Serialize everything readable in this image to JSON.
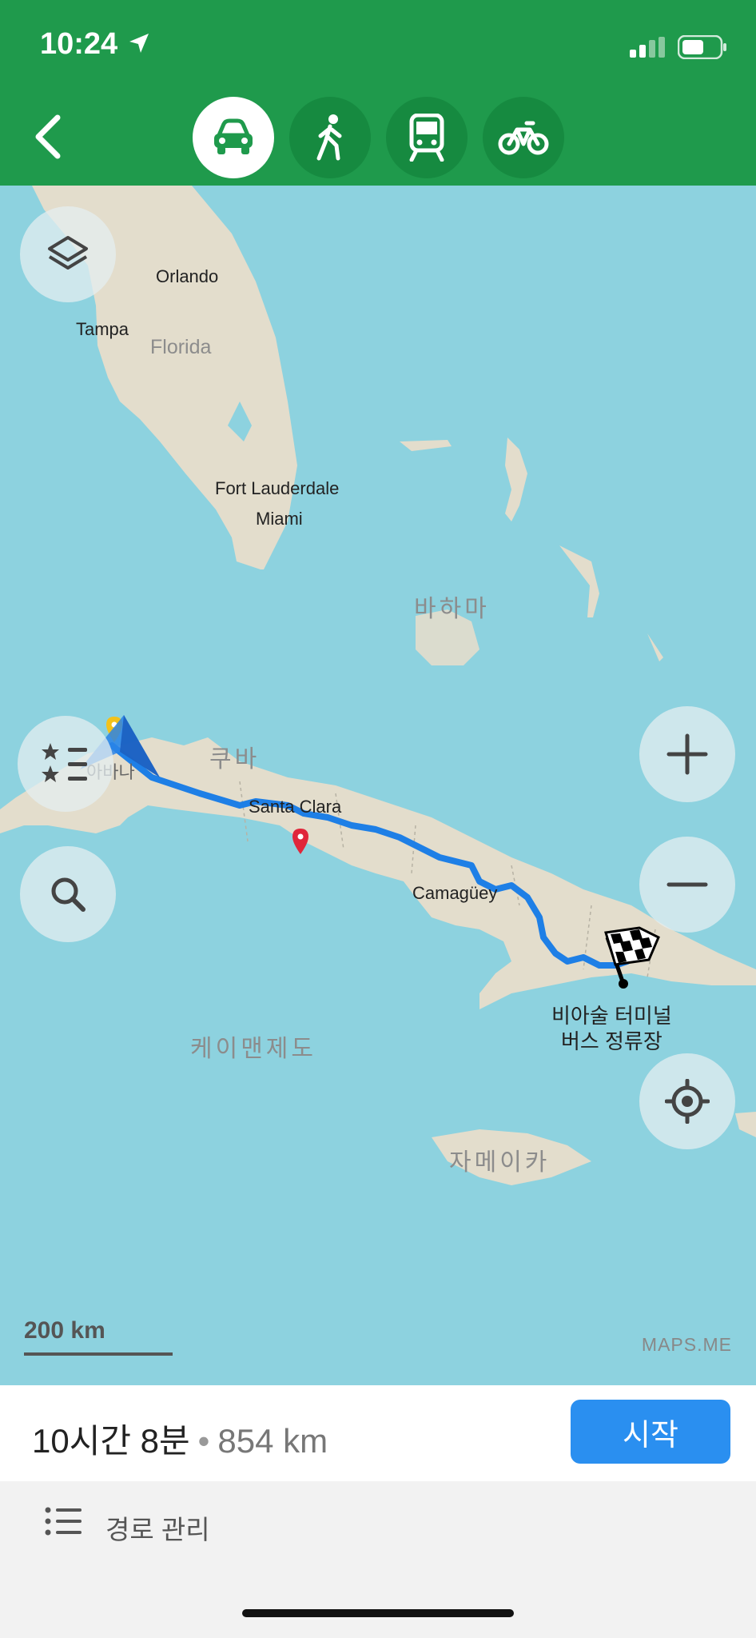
{
  "status_bar": {
    "time": "10:24"
  },
  "nav": {
    "modes": [
      {
        "icon": "car-icon",
        "active": true
      },
      {
        "icon": "walk-icon",
        "active": false
      },
      {
        "icon": "train-icon",
        "active": false
      },
      {
        "icon": "bicycle-icon",
        "active": false
      }
    ]
  },
  "map": {
    "labels": {
      "orlando": "Orlando",
      "tampa": "Tampa",
      "florida": "Florida",
      "fort_lauderdale": "Fort Lauderdale",
      "miami": "Miami",
      "bahamas": "바하마",
      "cuba": "쿠바",
      "havana": "아바나",
      "santa_clara": "Santa Clara",
      "camaguey": "Camagüey",
      "cayman": "케이맨제도",
      "jamaica": "자메이카",
      "destination_line1": "비아술 터미널",
      "destination_line2": "버스 정류장"
    },
    "scale": "200 km",
    "brand": "MAPS.ME"
  },
  "route": {
    "duration": "10시간 8분",
    "separator": "•",
    "distance": "854 km",
    "start_label": "시작",
    "manage_label": "경로 관리"
  },
  "colors": {
    "header_green": "#1f9a4c",
    "water": "#8dd2df",
    "land": "#e3ddcc",
    "route_blue": "#1e7fe6",
    "start_button": "#2a8ff0"
  }
}
